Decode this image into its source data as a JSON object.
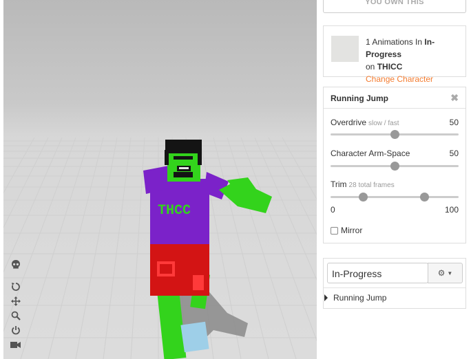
{
  "sidebar": {
    "own_label": "YOU OWN THIS",
    "anim_count": "1 Animations In",
    "pack_name": "In-Progress",
    "on_word": "on",
    "character_name": "THICC",
    "change_character": "Change Character"
  },
  "props": {
    "title": "Running Jump",
    "close_icon": "close-icon",
    "overdrive": {
      "label": "Overdrive",
      "hint": "slow / fast",
      "value": "50",
      "fraction": 0.5
    },
    "arm_space": {
      "label": "Character Arm-Space",
      "value": "50",
      "fraction": 0.5
    },
    "trim": {
      "label": "Trim",
      "hint": "28 total frames",
      "min": "0",
      "max": "100",
      "start_fraction": 0.25,
      "end_fraction": 0.73
    },
    "mirror_label": "Mirror",
    "mirror_checked": false
  },
  "queue": {
    "pack_value": "In-Progress",
    "gear_icon": "gear-icon",
    "items": [
      {
        "label": "Running Jump"
      }
    ]
  },
  "viewport": {
    "character_shirt_text": "THCC",
    "tools": [
      "skull-icon",
      "reset-icon",
      "move-icon",
      "zoom-icon",
      "power-icon",
      "camera-icon"
    ]
  },
  "colors": {
    "accent": "#f47c30",
    "floor": "#dcdcdc",
    "shirt": "#7b22c9",
    "skin": "#33d31c",
    "shorts": "#d31414"
  }
}
